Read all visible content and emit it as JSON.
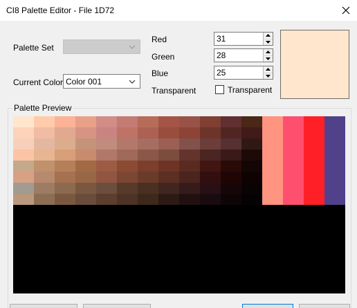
{
  "window": {
    "title": "CI8 Palette Editor - File 1D72"
  },
  "form": {
    "palette_set": {
      "label": "Palette Set",
      "value": ""
    },
    "current_color": {
      "label": "Current Color",
      "value": "Color 001"
    },
    "red": {
      "label": "Red",
      "value": "31"
    },
    "green": {
      "label": "Green",
      "value": "28"
    },
    "blue": {
      "label": "Blue",
      "value": "25"
    },
    "transparent": {
      "label": "Transparent",
      "checkbox_label": "Transparent",
      "checked": false
    },
    "preview_color": "#ffe6cd"
  },
  "preview": {
    "title": "Palette Preview",
    "grid_colors": [
      "#ffe6cd",
      "#ffcbab",
      "#fbb295",
      "#e9a089",
      "#d18d86",
      "#c37b72",
      "#b76c5a",
      "#a45546",
      "#995246",
      "#7f3f32",
      "#5f2f31",
      "#4a2717",
      "#fdd3ba",
      "#f1bca4",
      "#e1a990",
      "#d79484",
      "#c98481",
      "#be7366",
      "#ad6152",
      "#984d3d",
      "#8d4437",
      "#6d3529",
      "#512622",
      "#411a19",
      "#f7d0bc",
      "#e3b7a0",
      "#dcad8d",
      "#c39478",
      "#bf8c7d",
      "#b3786c",
      "#a56e61",
      "#9b5f53",
      "#83514b",
      "#6c3e3a",
      "#573032",
      "#301915",
      "#fbc4a5",
      "#e7b591",
      "#d79e7a",
      "#c88b6d",
      "#b1786a",
      "#a0695a",
      "#8a5749",
      "#7c4d3e",
      "#63342c",
      "#4a2522",
      "#3a1918",
      "#1d0a08",
      "#c4a98a",
      "#c0916d",
      "#b3805a",
      "#a16a45",
      "#9c5b43",
      "#8b4b32",
      "#7b3f2c",
      "#6d3426",
      "#5a2a20",
      "#401512",
      "#2a0a07",
      "#130605",
      "#d9a184",
      "#b7896f",
      "#a5714e",
      "#976746",
      "#915540",
      "#7b4732",
      "#6b3b2a",
      "#5b2f22",
      "#4b241e",
      "#320f0e",
      "#1f0605",
      "#0f0202",
      "#a19b92",
      "#9c7c62",
      "#8c6a4f",
      "#7a5840",
      "#6b4e3e",
      "#573a2a",
      "#4b2f21",
      "#412620",
      "#351c1a",
      "#2a1015",
      "#170608",
      "#0a0303",
      "#b9987d",
      "#8d6e53",
      "#7a5840",
      "#6a4c3b",
      "#5b3e2e",
      "#4d3325",
      "#3e281b",
      "#2e1a14",
      "#221011",
      "#190b10",
      "#0e0507",
      "#050203"
    ],
    "strip_colors": [
      "#ff9480",
      "#ff4f6f",
      "#ff2027",
      "#51418a"
    ]
  },
  "buttons": [
    {
      "label": ""
    },
    {
      "label": ""
    },
    {
      "label": ""
    },
    {
      "label": ""
    }
  ]
}
